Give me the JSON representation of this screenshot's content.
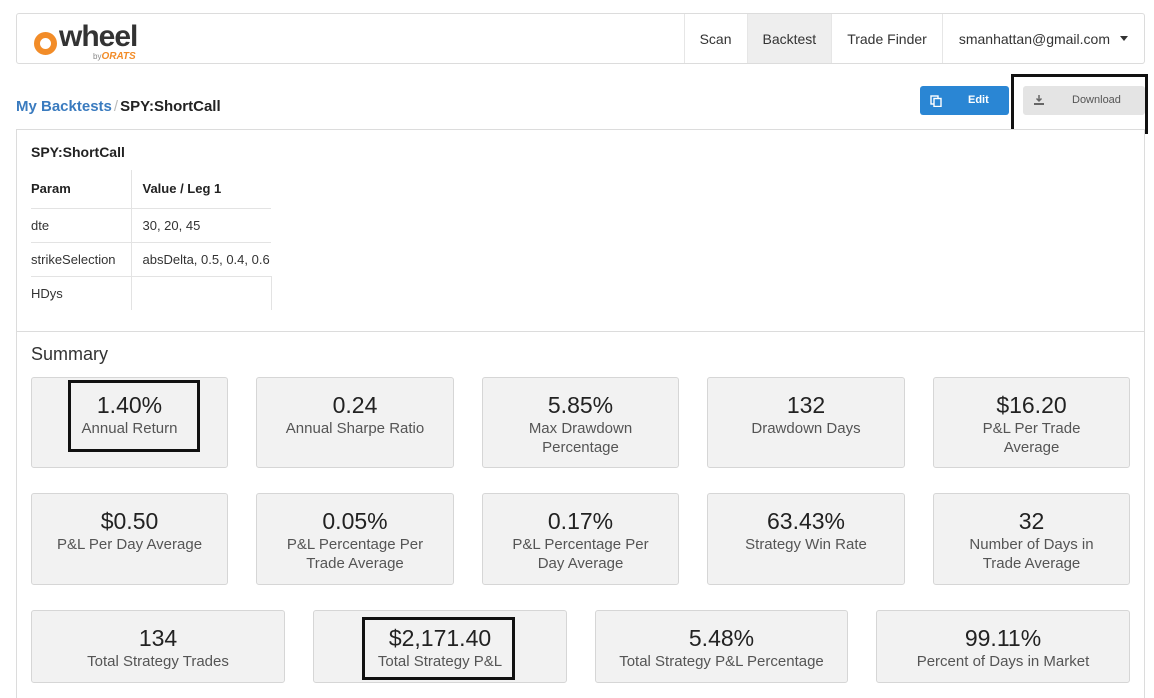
{
  "navbar": {
    "logo_text": "wheel",
    "logo_sub_prefix": "by",
    "logo_sub_brand": "ORATS",
    "items": [
      {
        "label": "Scan",
        "active": false
      },
      {
        "label": "Backtest",
        "active": true
      },
      {
        "label": "Trade Finder",
        "active": false
      }
    ],
    "user_email": "smanhattan@gmail.com"
  },
  "breadcrumb": {
    "parent": "My Backtests",
    "separator": "/",
    "current": "SPY:ShortCall"
  },
  "toolbar": {
    "edit_label": "Edit",
    "download_label": "Download"
  },
  "strategy": {
    "name": "SPY:ShortCall",
    "headers": [
      "Param",
      "Value / Leg 1"
    ],
    "rows": [
      {
        "param": "dte",
        "value": "30, 20, 45"
      },
      {
        "param": "strikeSelection",
        "value": "absDelta, 0.5, 0.4, 0.6"
      },
      {
        "param": "HDys",
        "value": ""
      }
    ]
  },
  "summary": {
    "title": "Summary",
    "row1": [
      {
        "value": "1.40%",
        "label": "Annual Return"
      },
      {
        "value": "0.24",
        "label": "Annual Sharpe Ratio"
      },
      {
        "value": "5.85%",
        "label": "Max Drawdown Percentage"
      },
      {
        "value": "132",
        "label": "Drawdown Days"
      },
      {
        "value": "$16.20",
        "label": "P&L Per Trade Average"
      }
    ],
    "row2": [
      {
        "value": "$0.50",
        "label": "P&L Per Day Average"
      },
      {
        "value": "0.05%",
        "label": "P&L Percentage Per Trade Average"
      },
      {
        "value": "0.17%",
        "label": "P&L Percentage Per Day Average"
      },
      {
        "value": "63.43%",
        "label": "Strategy Win Rate"
      },
      {
        "value": "32",
        "label": "Number of Days in Trade Average"
      }
    ],
    "row3": [
      {
        "value": "134",
        "label": "Total Strategy Trades"
      },
      {
        "value": "$2,171.40",
        "label": "Total Strategy P&L"
      },
      {
        "value": "5.48%",
        "label": "Total Strategy P&L Percentage"
      },
      {
        "value": "99.11%",
        "label": "Percent of Days in Market"
      }
    ]
  }
}
